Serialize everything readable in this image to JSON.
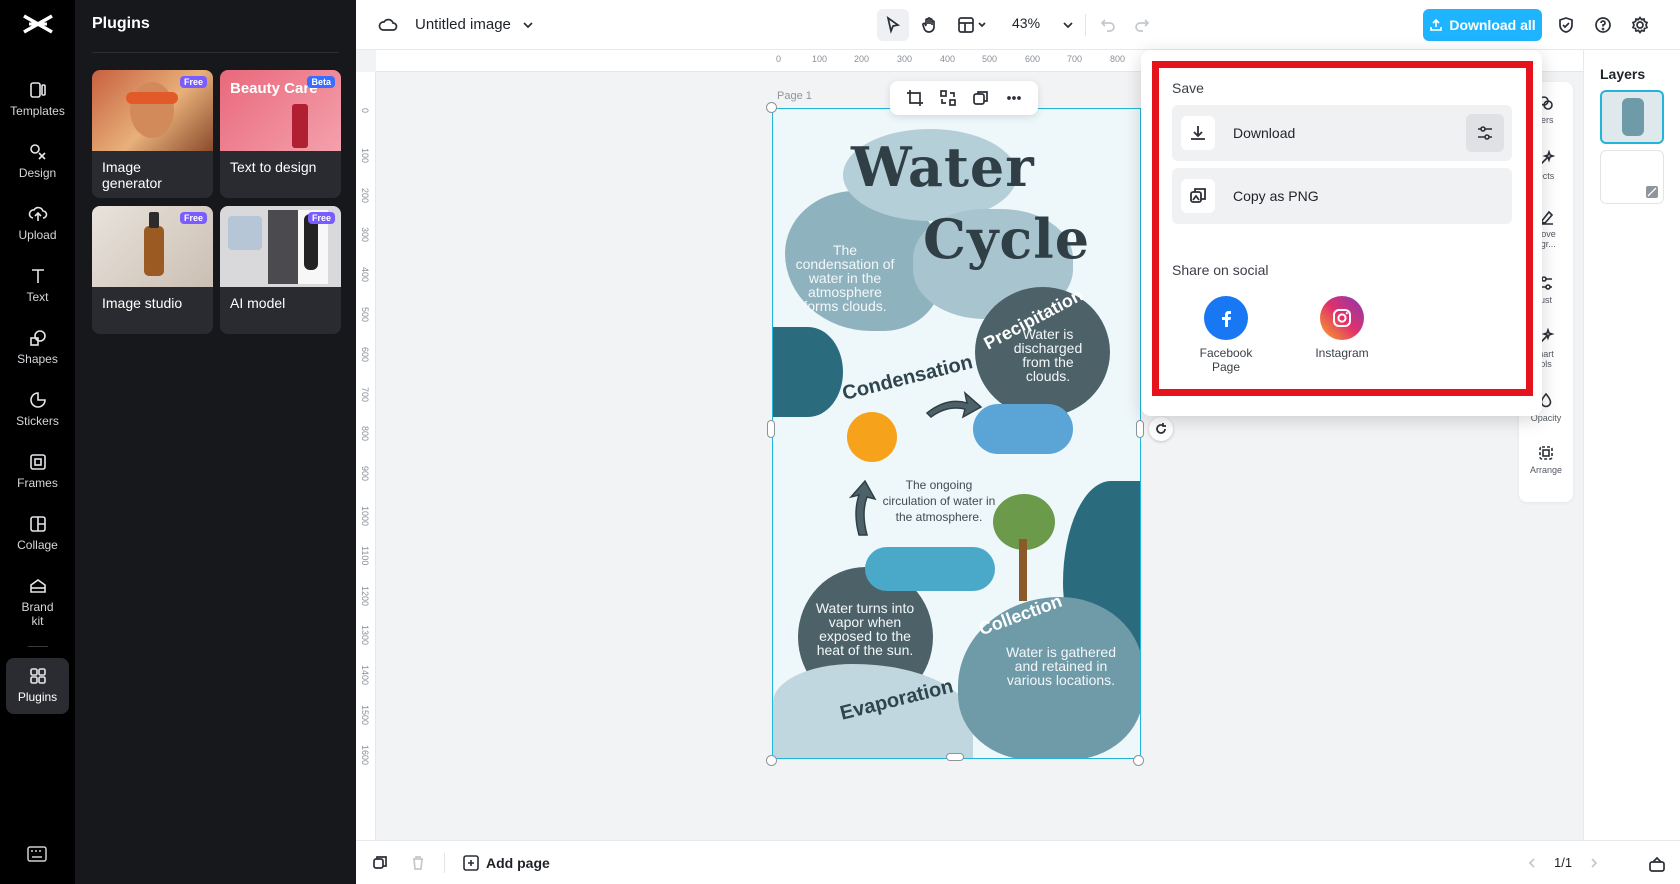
{
  "app": {
    "title": "Untitled image",
    "zoom": "43%"
  },
  "rail": {
    "items": [
      {
        "label": "Templates",
        "icon": "templates-icon"
      },
      {
        "label": "Design",
        "icon": "design-icon"
      },
      {
        "label": "Upload",
        "icon": "upload-icon"
      },
      {
        "label": "Text",
        "icon": "text-icon"
      },
      {
        "label": "Shapes",
        "icon": "shapes-icon"
      },
      {
        "label": "Stickers",
        "icon": "stickers-icon"
      },
      {
        "label": "Frames",
        "icon": "frames-icon"
      },
      {
        "label": "Collage",
        "icon": "collage-icon"
      },
      {
        "label": "Brand\nkit",
        "icon": "brand-kit-icon"
      },
      {
        "label": "Plugins",
        "icon": "plugins-icon"
      }
    ],
    "active": "Plugins"
  },
  "plugins": {
    "title": "Plugins",
    "cards": [
      {
        "label": "Image generator",
        "badge": "Free"
      },
      {
        "label": "Text to design",
        "badge": "Beta",
        "thumb_text": "Beauty Care"
      },
      {
        "label": "Image studio",
        "badge": "Free"
      },
      {
        "label": "AI model",
        "badge": "Free"
      }
    ]
  },
  "toolbar": {
    "download_all": "Download all"
  },
  "canvas": {
    "page_label": "Page 1",
    "ruler_h": [
      "0",
      "100",
      "200",
      "300",
      "400",
      "500",
      "600",
      "700",
      "800"
    ],
    "ruler_v": [
      "0",
      "100",
      "200",
      "300",
      "400",
      "500",
      "600",
      "700",
      "800",
      "900",
      "1000",
      "1100",
      "1200",
      "1300",
      "1400",
      "1500",
      "1600"
    ]
  },
  "infographic": {
    "title_1": "Water",
    "title_2": "Cycle",
    "condensation_text": "The condensation of water in the atmosphere forms clouds.",
    "condensation_label": "Condensation",
    "precipitation_label": "Precipitation",
    "precipitation_text": "Water is discharged from the clouds.",
    "center_text": "The ongoing circulation of water in the atmosphere.",
    "evaporation_text": "Water turns into vapor when exposed to the heat of the sun.",
    "evaporation_label": "Evaporation",
    "collection_label": "Collection",
    "collection_text": "Water is gathered and retained in various locations."
  },
  "props": [
    {
      "label": "ters"
    },
    {
      "label": "ects"
    },
    {
      "label": "nove\nkgr..."
    },
    {
      "label": "ust"
    },
    {
      "label": "nart\nols"
    },
    {
      "label": "Opacity"
    },
    {
      "label": "Arrange"
    }
  ],
  "layers": {
    "title": "Layers"
  },
  "bottom": {
    "add_page": "Add page",
    "pager": "1/1"
  },
  "popover": {
    "save_heading": "Save",
    "download": "Download",
    "copy_png": "Copy as PNG",
    "share_heading": "Share on social",
    "facebook": "Facebook\nPage",
    "instagram": "Instagram"
  },
  "colors": {
    "accent": "#1fb4ff",
    "highlight": "#e5131b",
    "selection": "#23b5d9"
  }
}
